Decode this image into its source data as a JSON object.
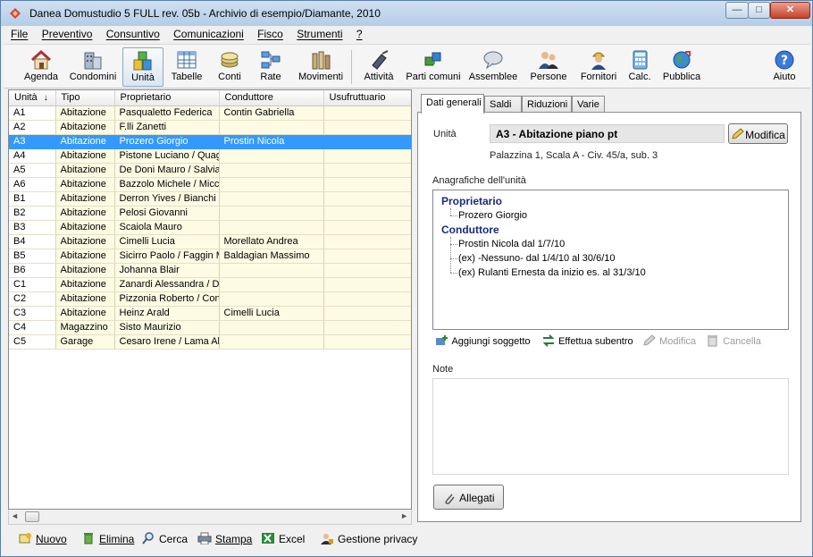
{
  "window": {
    "title": "Danea Domustudio 5 FULL rev. 05b - Archivio di esempio/Diamante, 2010",
    "min_glyph": "—",
    "max_glyph": "□",
    "close_glyph": "✕"
  },
  "menu": [
    "File",
    "Preventivo",
    "Consuntivo",
    "Comunicazioni",
    "Fisco",
    "Strumenti",
    "?"
  ],
  "toolbar": {
    "agenda": "Agenda",
    "condomini": "Condomini",
    "unita": "Unità",
    "tabelle": "Tabelle",
    "conti": "Conti",
    "rate": "Rate",
    "movimenti": "Movimenti",
    "attivita": "Attività",
    "parti_comuni": "Parti comuni",
    "assemblee": "Assemblee",
    "persone": "Persone",
    "fornitori": "Fornitori",
    "calc": "Calc.",
    "pubblica": "Pubblica",
    "aiuto": "Aiuto"
  },
  "grid": {
    "columns": [
      "Unità",
      "Tipo",
      "Proprietario",
      "Conduttore",
      "Usufruttuario"
    ],
    "sort_indicator": "↓",
    "rows": [
      [
        "A1",
        "Abitazione",
        "Pasqualetto Federica",
        "Contin Gabriella",
        ""
      ],
      [
        "A2",
        "Abitazione",
        "F.lli Zanetti",
        "",
        ""
      ],
      [
        "A3",
        "Abitazione",
        "Prozero Giorgio",
        "Prostin Nicola",
        ""
      ],
      [
        "A4",
        "Abitazione",
        "Pistone Luciano / Quag",
        "",
        ""
      ],
      [
        "A5",
        "Abitazione",
        "De Doni Mauro / Salvia",
        "",
        ""
      ],
      [
        "A6",
        "Abitazione",
        "Bazzolo Michele / Micc",
        "",
        ""
      ],
      [
        "B1",
        "Abitazione",
        "Derron Yives / Bianchi .",
        "",
        ""
      ],
      [
        "B2",
        "Abitazione",
        "Pelosi Giovanni",
        "",
        ""
      ],
      [
        "B3",
        "Abitazione",
        "Scaiola Mauro",
        "",
        ""
      ],
      [
        "B4",
        "Abitazione",
        "Cimelli Lucia",
        "Morellato Andrea",
        ""
      ],
      [
        "B5",
        "Abitazione",
        "Sicirro Paolo / Faggin M",
        "Baldagian Massimo",
        ""
      ],
      [
        "B6",
        "Abitazione",
        "Johanna Blair",
        "",
        ""
      ],
      [
        "C1",
        "Abitazione",
        "Zanardi Alessandra / D",
        "",
        ""
      ],
      [
        "C2",
        "Abitazione",
        "Pizzonia Roberto / Con",
        "",
        ""
      ],
      [
        "C3",
        "Abitazione",
        "Heinz Arald",
        "Cimelli Lucia",
        ""
      ],
      [
        "C4",
        "Magazzino",
        "Sisto Maurizio",
        "",
        ""
      ],
      [
        "C5",
        "Garage",
        "Cesaro Irene / Lama Ali",
        "",
        ""
      ]
    ],
    "selected_index": 2
  },
  "scroll": {
    "left": "◄",
    "right": "►"
  },
  "tabs": [
    "Dati generali",
    "Saldi",
    "Riduzioni",
    "Varie"
  ],
  "detail": {
    "unita_label": "Unità",
    "unita_value": "A3 - Abitazione piano pt",
    "modifica_label": "Modifica",
    "address": "Palazzina 1, Scala A - Civ. 45/a, sub. 3",
    "anagrafiche_label": "Anagrafiche dell'unità",
    "proprietario_header": "Proprietario",
    "proprietario": "Prozero Giorgio",
    "conduttore_header": "Conduttore",
    "conduttori": [
      "Prostin Nicola dal 1/7/10",
      "(ex) -Nessuno- dal 1/4/10 al 30/6/10",
      "(ex) Rulanti Ernesta da inizio es. al 31/3/10"
    ],
    "actions": {
      "aggiungi": "Aggiungi soggetto",
      "subentro": "Effettua subentro",
      "modifica": "Modifica",
      "cancella": "Cancella"
    },
    "note_label": "Note",
    "allegati_label": "Allegati"
  },
  "bottom": {
    "nuovo": "Nuovo",
    "elimina": "Elimina",
    "cerca": "Cerca",
    "stampa": "Stampa",
    "excel": "Excel",
    "privacy": "Gestione privacy"
  }
}
